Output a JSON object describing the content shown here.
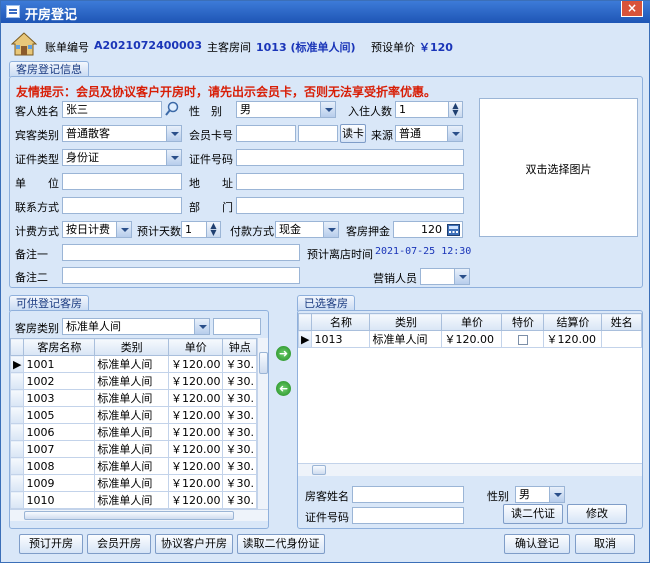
{
  "window": {
    "title": "开房登记",
    "close": "×"
  },
  "header": {
    "bill_no_label": "账单编号",
    "bill_no": "A2021072400003",
    "room_label": "主客房间",
    "room": "1013 (标准单人间)",
    "price_label": "预设单价",
    "price": "￥120"
  },
  "info": {
    "tab": "客房登记信息",
    "notice": "友情提示：会员及协议客户开房时，请先出示会员卡，否则无法享受折率优惠。",
    "name_label": "客人姓名",
    "name": "张三",
    "gender_label": "性　别",
    "gender": "男",
    "people_label": "入住人数",
    "people": "1",
    "guest_type_label": "宾客类别",
    "guest_type": "普通散客",
    "member_card_label": "会员卡号",
    "read_card": "读卡",
    "source_label": "来源",
    "source": "普通",
    "id_type_label": "证件类型",
    "id_type": "身份证",
    "id_no_label": "证件号码",
    "unit_label": "单　　位",
    "address_label": "地　　址",
    "contact_label": "联系方式",
    "dept_label": "部　　门",
    "billing_label": "计费方式",
    "billing": "按日计费",
    "days_label": "预计天数",
    "days": "1",
    "pay_label": "付款方式",
    "pay": "现金",
    "deposit_label": "客房押金",
    "deposit": "120",
    "note1_label": "备注一",
    "note2_label": "备注二",
    "checkout_label": "预计离店时间",
    "checkout": "2021-07-25 12:30",
    "sales_label": "营销人员",
    "photo_text": "双击选择图片"
  },
  "available": {
    "tab": "可供登记客房",
    "type_label": "客房类别",
    "type": "标准单人间",
    "columns": [
      "客房名称",
      "类别",
      "单价",
      "钟点"
    ],
    "rows": [
      [
        "1001",
        "标准单人间",
        "￥120.00",
        "￥30."
      ],
      [
        "1002",
        "标准单人间",
        "￥120.00",
        "￥30."
      ],
      [
        "1003",
        "标准单人间",
        "￥120.00",
        "￥30."
      ],
      [
        "1005",
        "标准单人间",
        "￥120.00",
        "￥30."
      ],
      [
        "1006",
        "标准单人间",
        "￥120.00",
        "￥30."
      ],
      [
        "1007",
        "标准单人间",
        "￥120.00",
        "￥30."
      ],
      [
        "1008",
        "标准单人间",
        "￥120.00",
        "￥30."
      ],
      [
        "1009",
        "标准单人间",
        "￥120.00",
        "￥30."
      ],
      [
        "1010",
        "标准单人间",
        "￥120.00",
        "￥30."
      ]
    ]
  },
  "selected": {
    "tab": "已选客房",
    "columns": [
      "名称",
      "类别",
      "单价",
      "特价",
      "结算价",
      "姓名"
    ],
    "rows": [
      [
        "1013",
        "标准单人间",
        "￥120.00",
        "",
        "￥120.00",
        ""
      ]
    ],
    "guest_name_label": "房客姓名",
    "id_no_label": "证件号码",
    "gender_label": "性别",
    "gender": "男",
    "read_id": "读二代证",
    "modify": "修改"
  },
  "footer": {
    "reserve": "预订开房",
    "member": "会员开房",
    "agreement": "协议客户开房",
    "read_id": "读取二代身份证",
    "confirm": "确认登记",
    "cancel": "取消"
  },
  "colors": {
    "title_bar": "#1e55b5",
    "notice": "#d81e06",
    "accent": "#1a35b8"
  }
}
